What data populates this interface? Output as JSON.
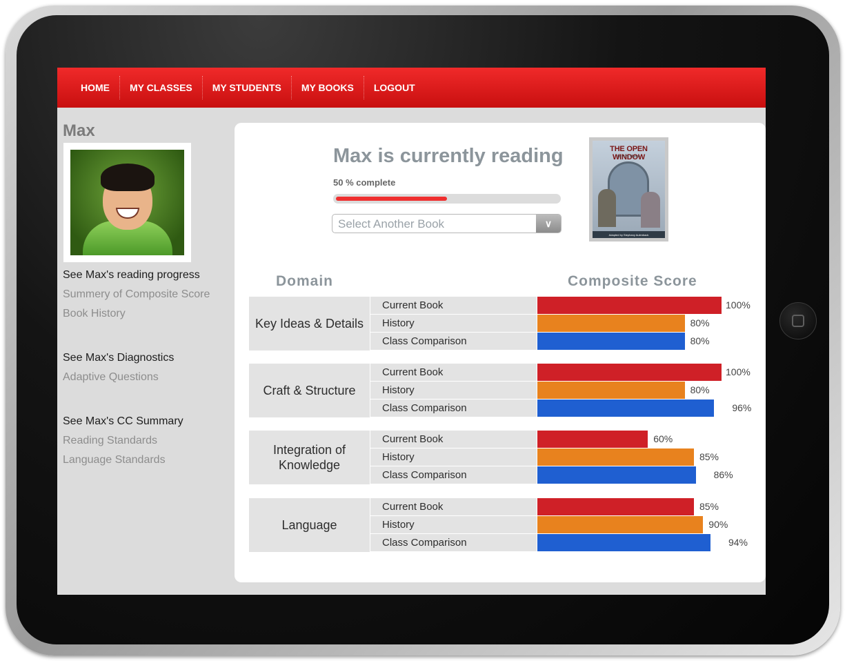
{
  "nav": [
    "HOME",
    "MY CLASSES",
    "MY STUDENTS",
    "MY BOOKS",
    "LOGOUT"
  ],
  "student": {
    "name": "Max",
    "sections": [
      {
        "head": "See Max's reading progress",
        "links": [
          "Summery of Composite Score",
          "Book History"
        ]
      },
      {
        "head": "See Max's Diagnostics",
        "links": [
          "Adaptive Questions"
        ]
      },
      {
        "head": "See Max's CC Summary",
        "links": [
          "Reading Standards",
          "Language Standards"
        ]
      }
    ]
  },
  "reading": {
    "title": "Max is currently reading",
    "percent_text": "50 % complete",
    "progress": 0.5,
    "select_placeholder": "Select Another Book",
    "book_title": "THE OPEN WINDOW",
    "book_author": "by H.H. Munro",
    "book_credit": "Adapted by Stephany Aulenback"
  },
  "table": {
    "domain_header": "Domain",
    "score_header": "Composite Score",
    "metric_labels": [
      "Current Book",
      "History",
      "Class Comparison"
    ],
    "colors": {
      "current": "#cf2027",
      "history": "#e8821e",
      "class": "#1f5fd1"
    }
  },
  "chart_data": {
    "type": "bar",
    "categories": [
      "Key Ideas & Details",
      "Craft & Structure",
      "Integration of Knowledge",
      "Language"
    ],
    "series": [
      {
        "name": "Current Book",
        "values": [
          100,
          100,
          60,
          85
        ],
        "labels": [
          "100%",
          "100%",
          "60%",
          "85%"
        ]
      },
      {
        "name": "History",
        "values": [
          80,
          80,
          85,
          90
        ],
        "labels": [
          "80%",
          "80%",
          "85%",
          "90%"
        ]
      },
      {
        "name": "Class Comparison",
        "values": [
          80,
          96,
          86,
          94
        ],
        "labels": [
          "80%",
          "96%",
          "86%",
          "94%"
        ]
      }
    ],
    "xlim": [
      0,
      100
    ]
  }
}
